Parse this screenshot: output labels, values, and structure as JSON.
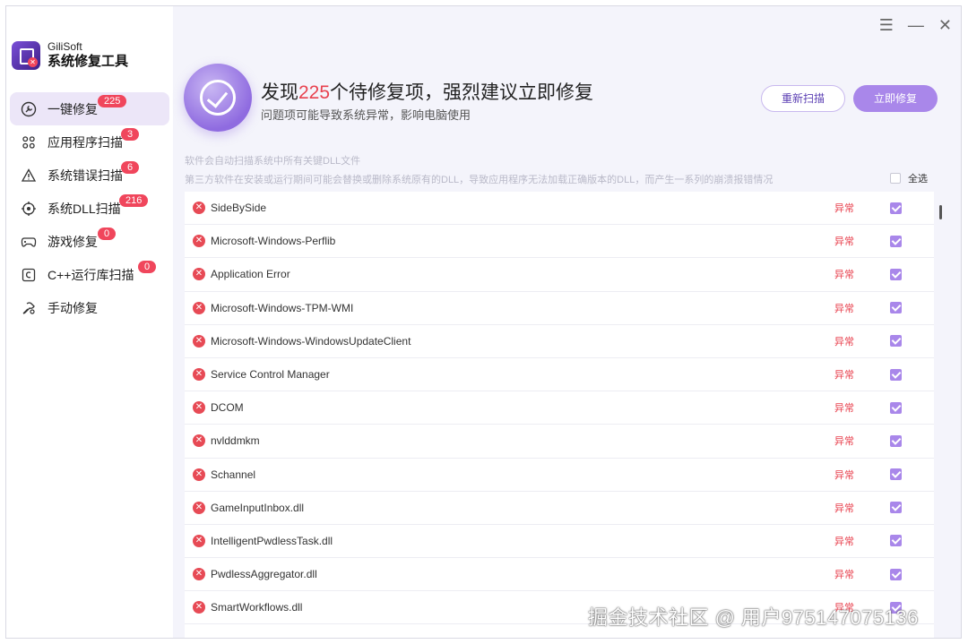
{
  "brand": {
    "name": "GiliSoft",
    "title": "系统修复工具"
  },
  "window_controls": {
    "menu": "☰",
    "minimize": "—",
    "close": "✕"
  },
  "sidebar": {
    "items": [
      {
        "label": "一键修复",
        "badge": "225",
        "icon": "wrench-circle-icon"
      },
      {
        "label": "应用程序扫描",
        "badge": "3",
        "icon": "app-grid-icon"
      },
      {
        "label": "系统错误扫描",
        "badge": "6",
        "icon": "warning-icon"
      },
      {
        "label": "系统DLL扫描",
        "badge": "216",
        "icon": "target-icon"
      },
      {
        "label": "游戏修复",
        "badge": "0",
        "icon": "gamepad-icon"
      },
      {
        "label": "C++运行库扫描",
        "badge": "0",
        "icon": "cpp-icon"
      },
      {
        "label": "手动修复",
        "badge": "",
        "icon": "hand-tool-icon"
      }
    ]
  },
  "hero": {
    "prefix": "发现",
    "count": "225",
    "suffix": "个待修复项，强烈建议立即修复",
    "subtitle": "问题项可能导致系统异常，影响电脑使用"
  },
  "buttons": {
    "rescan": "重新扫描",
    "fix": "立即修复"
  },
  "info": {
    "line1": "软件会自动扫描系统中所有关键DLL文件",
    "line2": "第三方软件在安装或运行期间可能会替换或删除系统原有的DLL，导致应用程序无法加载正确版本的DLL，而产生一系列的崩溃报错情况"
  },
  "select_all": "全选",
  "issues": [
    {
      "name": "SideBySide",
      "status": "异常"
    },
    {
      "name": "Microsoft-Windows-Perflib",
      "status": "异常"
    },
    {
      "name": "Application Error",
      "status": "异常"
    },
    {
      "name": "Microsoft-Windows-TPM-WMI",
      "status": "异常"
    },
    {
      "name": "Microsoft-Windows-WindowsUpdateClient",
      "status": "异常"
    },
    {
      "name": "Service Control Manager",
      "status": "异常"
    },
    {
      "name": "DCOM",
      "status": "异常"
    },
    {
      "name": "nvlddmkm",
      "status": "异常"
    },
    {
      "name": "Schannel",
      "status": "异常"
    },
    {
      "name": "GameInputInbox.dll",
      "status": "异常"
    },
    {
      "name": "IntelligentPwdlessTask.dll",
      "status": "异常"
    },
    {
      "name": "PwdlessAggregator.dll",
      "status": "异常"
    },
    {
      "name": "SmartWorkflows.dll",
      "status": "异常"
    }
  ],
  "watermark": "掘金技术社区 @ 用户975147075136"
}
